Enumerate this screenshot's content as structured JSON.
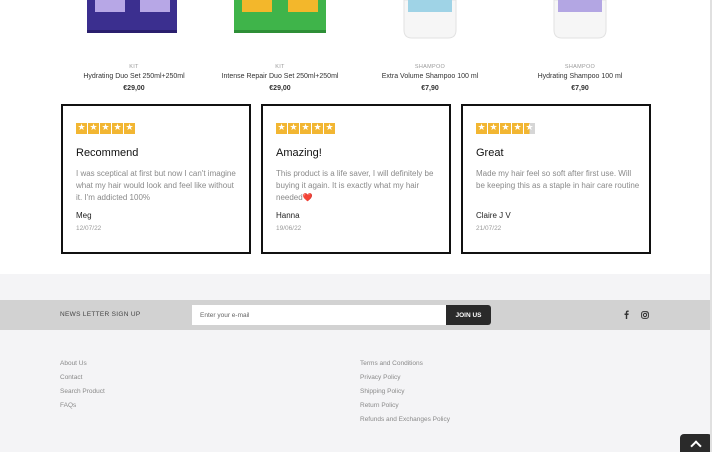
{
  "products": [
    {
      "category": "KIT",
      "name": "Hydrating Duo Set 250ml+250ml",
      "price": "€29,00",
      "image_colors": [
        "#3b2f8f",
        "#b7a7e6"
      ]
    },
    {
      "category": "KIT",
      "name": "Intense Repair Duo Set 250ml+250ml",
      "price": "€29,00",
      "image_colors": [
        "#3fb44a",
        "#f3b72b"
      ]
    },
    {
      "category": "SHAMPOO",
      "name": "Extra Volume Shampoo 100 ml",
      "price": "€7,90",
      "image_colors": [
        "#f4f4f4",
        "#9fd3e6"
      ]
    },
    {
      "category": "SHAMPOO",
      "name": "Hydrating Shampoo 100 ml",
      "price": "€7,90",
      "image_colors": [
        "#f4f4f4",
        "#b3a6e3"
      ]
    }
  ],
  "reviews": [
    {
      "rating": 5,
      "title": "Recommend",
      "body": "I was sceptical at first but now I can't imagine what my hair would look and feel like without it. I'm addicted 100%",
      "author": "Meg",
      "date": "12/07/22"
    },
    {
      "rating": 5,
      "title": "Amazing!",
      "body": "This product is a life saver, I will definitely be buying it again. It is exactly what my hair needed",
      "body_emoji": "❤️",
      "author": "Hanna",
      "date": "19/06/22"
    },
    {
      "rating": 4.5,
      "title": "Great",
      "body": "Made my hair feel so soft after first use. Will be keeping this as a staple in hair care routine",
      "author": "Claire J V",
      "date": "21/07/22"
    }
  ],
  "newsletter": {
    "label": "NEWS LETTER SIGN UP",
    "placeholder": "Enter your e-mail",
    "button": "JOIN US",
    "social_icons": [
      "facebook-icon",
      "instagram-icon"
    ]
  },
  "footer": {
    "col1": [
      "About Us",
      "Contact",
      "Search Product",
      "FAQs"
    ],
    "col2": [
      "Terms and Conditions",
      "Privacy Policy",
      "Shipping Policy",
      "Return Policy",
      "Refunds and Exchanges Policy"
    ]
  },
  "colors": {
    "star": "#f2b632",
    "star_empty": "#d6d6d6",
    "button_dark": "#2a2a2a",
    "newsletter_bg": "#d2d2d2",
    "footer_bg": "#f4f4f6"
  }
}
